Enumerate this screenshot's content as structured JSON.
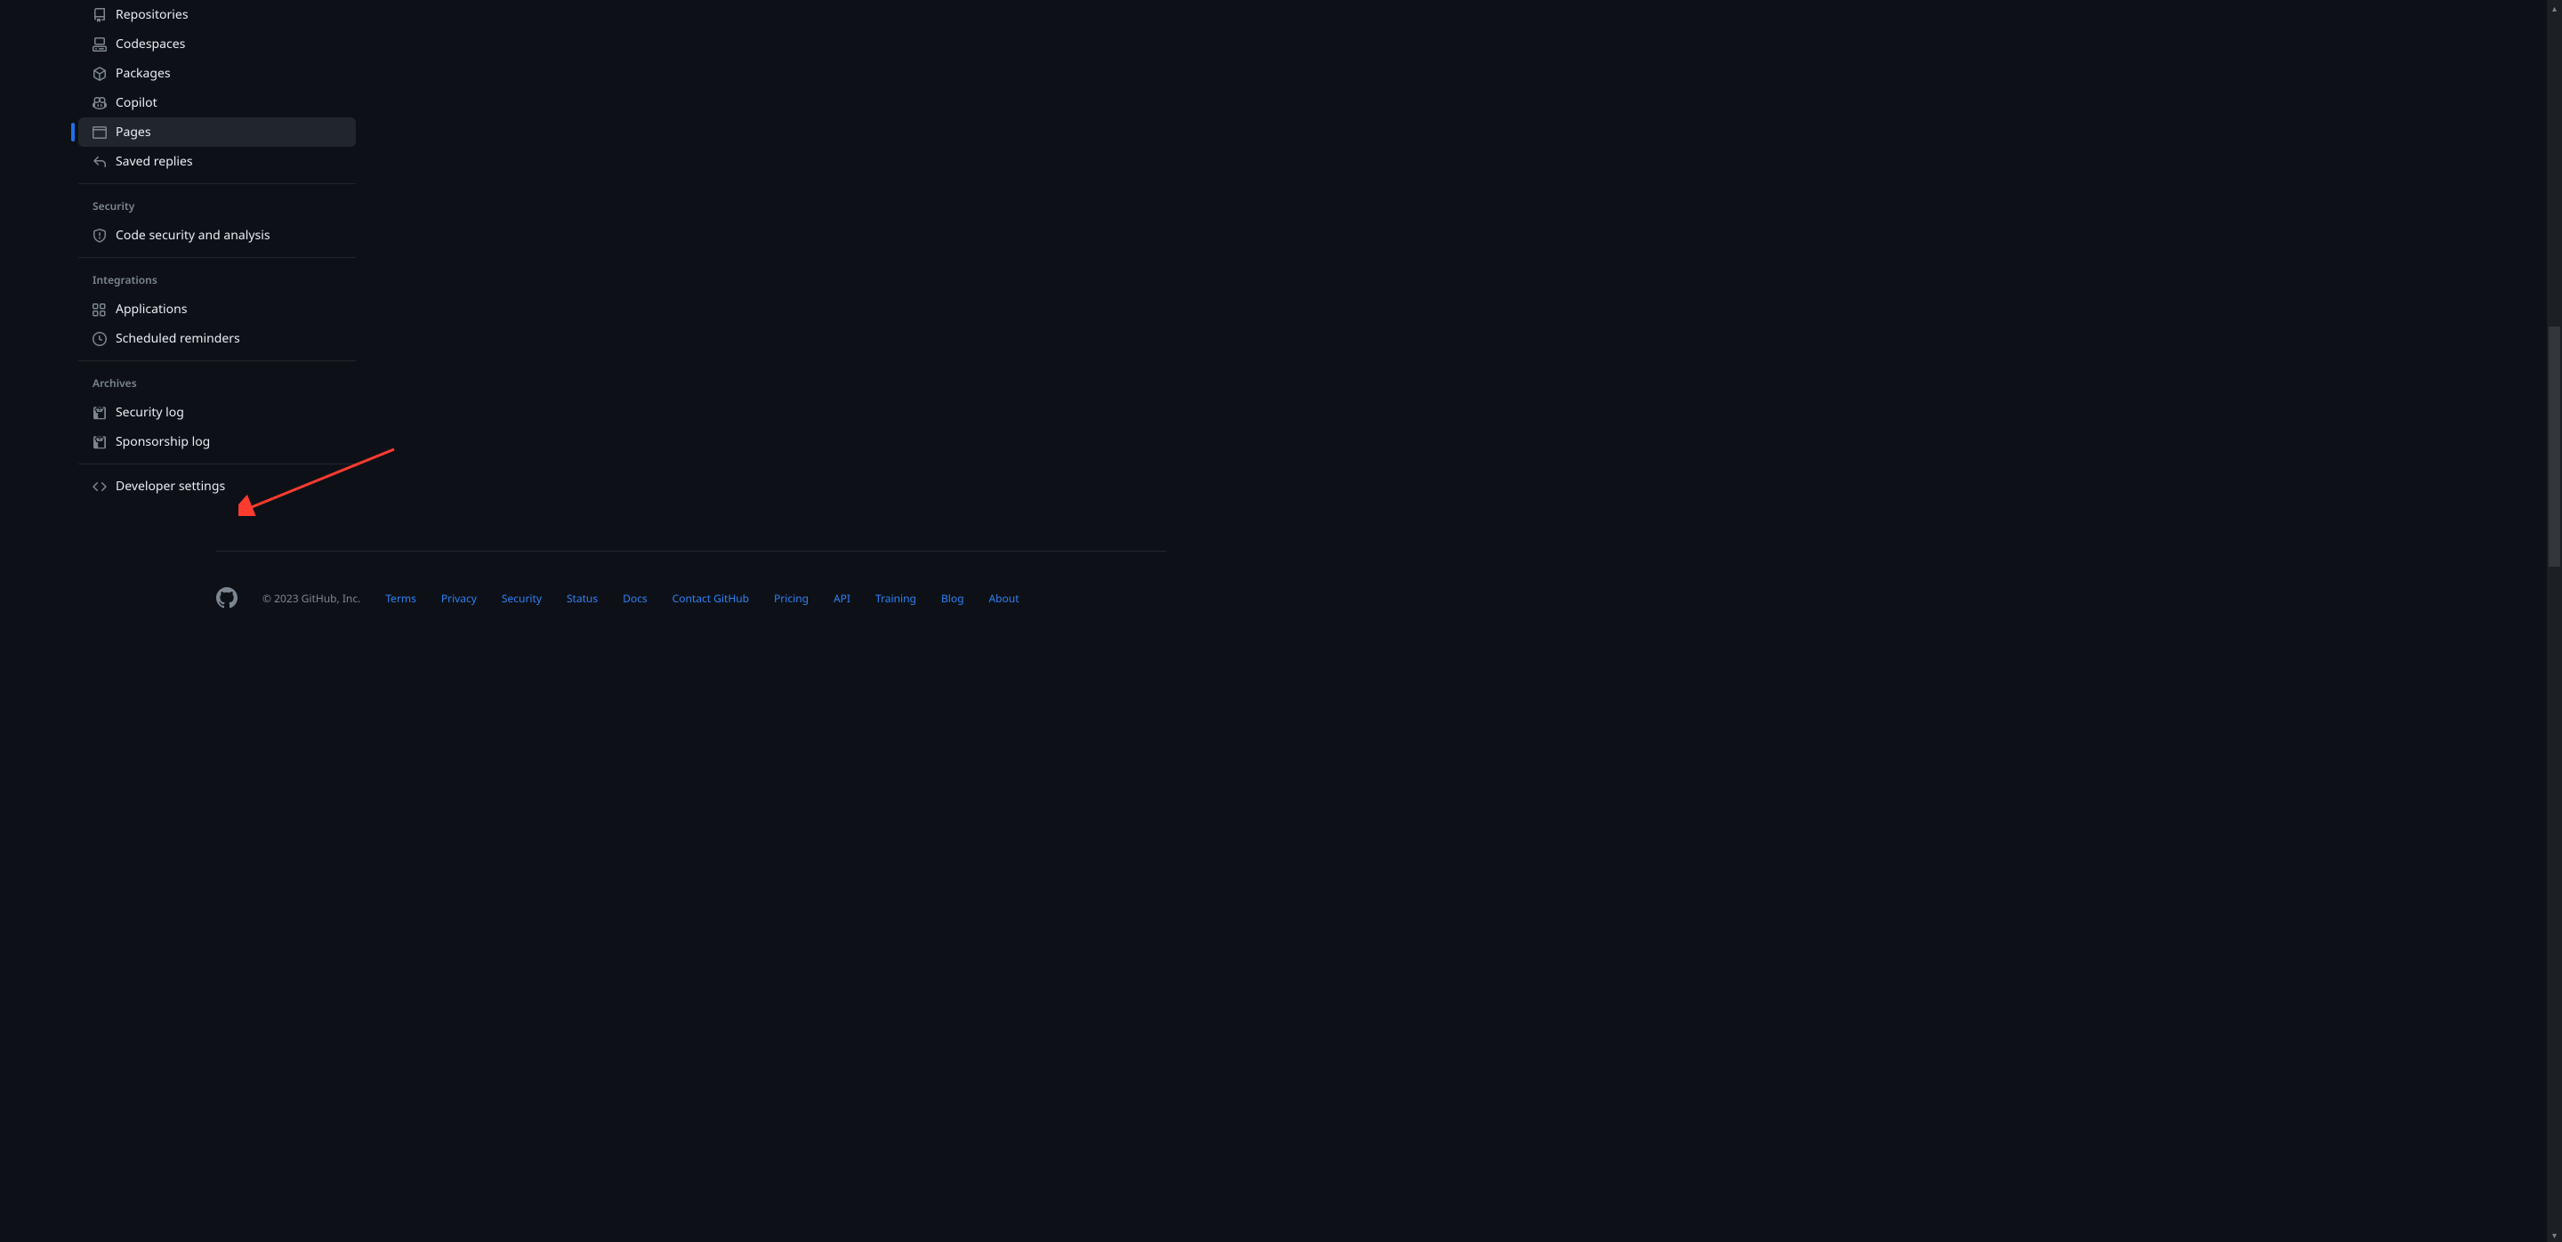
{
  "sidebar": {
    "section1": {
      "items": [
        {
          "label": "Repositories"
        },
        {
          "label": "Codespaces"
        },
        {
          "label": "Packages"
        },
        {
          "label": "Copilot"
        },
        {
          "label": "Pages"
        },
        {
          "label": "Saved replies"
        }
      ]
    },
    "section2": {
      "header": "Security",
      "items": [
        {
          "label": "Code security and analysis"
        }
      ]
    },
    "section3": {
      "header": "Integrations",
      "items": [
        {
          "label": "Applications"
        },
        {
          "label": "Scheduled reminders"
        }
      ]
    },
    "section4": {
      "header": "Archives",
      "items": [
        {
          "label": "Security log"
        },
        {
          "label": "Sponsorship log"
        }
      ]
    },
    "developer": {
      "label": "Developer settings"
    }
  },
  "footer": {
    "copyright": "© 2023 GitHub, Inc.",
    "links": [
      "Terms",
      "Privacy",
      "Security",
      "Status",
      "Docs",
      "Contact GitHub",
      "Pricing",
      "API",
      "Training",
      "Blog",
      "About"
    ]
  }
}
